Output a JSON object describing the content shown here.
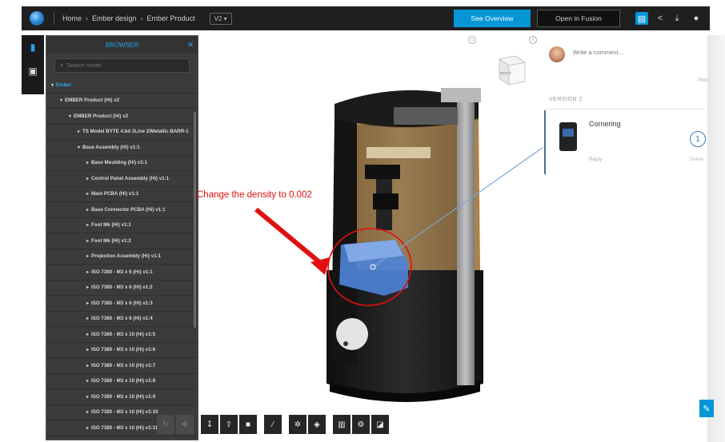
{
  "topbar": {
    "breadcrumbs": [
      "Home",
      "Ember design",
      "Ember Product"
    ],
    "version": "V2",
    "primary_button": "See Overview",
    "secondary_button": "Open in Fusion"
  },
  "browser": {
    "title": "BROWSER",
    "search_placeholder": "Search model",
    "items": [
      {
        "label": "Ember",
        "depth": 0
      },
      {
        "label": "EMBER Product (Hi) v2",
        "depth": 1
      },
      {
        "label": "EMBER Product (Hi) v2",
        "depth": 2
      },
      {
        "label": "TS Model BYTE 4.bd 3Line 2/Metallic BARR-1",
        "depth": 3
      },
      {
        "label": "Base Assembly (Hi) v1:1",
        "depth": 3
      },
      {
        "label": "Base Moulding (Hi) v1:1",
        "depth": 4
      },
      {
        "label": "Control Panel Assembly (Hi) v1:1",
        "depth": 4
      },
      {
        "label": "Main PCBA (Hi) v1:1",
        "depth": 4
      },
      {
        "label": "Base Connector PCBA (Hi) v1:1",
        "depth": 4
      },
      {
        "label": "Foot Mk (Hi) v1:1",
        "depth": 4
      },
      {
        "label": "Foot Mk (Hi) v1:2",
        "depth": 4
      },
      {
        "label": "Projection Assembly (Hi) v1:1",
        "depth": 4
      },
      {
        "label": "ISO 7380 - M3 x 6 (Hi) v1:1",
        "depth": 4
      },
      {
        "label": "ISO 7380 - M3 x 6 (Hi) v1:2",
        "depth": 4
      },
      {
        "label": "ISO 7380 - M3 x 6 (Hi) v1:3",
        "depth": 4
      },
      {
        "label": "ISO 7380 - M3 x 6 (Hi) v1:4",
        "depth": 4
      },
      {
        "label": "ISO 7380 - M3 x 10 (Hi) v1:5",
        "depth": 4
      },
      {
        "label": "ISO 7380 - M3 x 10 (Hi) v1:6",
        "depth": 4
      },
      {
        "label": "ISO 7380 - M3 x 10 (Hi) v1:7",
        "depth": 4
      },
      {
        "label": "ISO 7380 - M3 x 10 (Hi) v1:8",
        "depth": 4
      },
      {
        "label": "ISO 7380 - M3 x 10 (Hi) v1:9",
        "depth": 4
      },
      {
        "label": "ISO 7380 - M3 x 10 (Hi) v1:10",
        "depth": 4
      },
      {
        "label": "ISO 7380 - M3 x 10 (Hi) v1:11",
        "depth": 4
      }
    ]
  },
  "viewport": {
    "annotation_text": "Change the density to 0.002",
    "viewcube_label": "RIGHT"
  },
  "comments": {
    "input_placeholder": "Write a comment...",
    "post_label": "Post",
    "version_label": "VERSION 2",
    "item_text": "Cornering",
    "reply_label": "Reply",
    "count": "1",
    "edge_label": "Delete"
  },
  "colors": {
    "accent": "#0696d7",
    "annotation": "#e01010",
    "selection": "#4d84d8"
  }
}
